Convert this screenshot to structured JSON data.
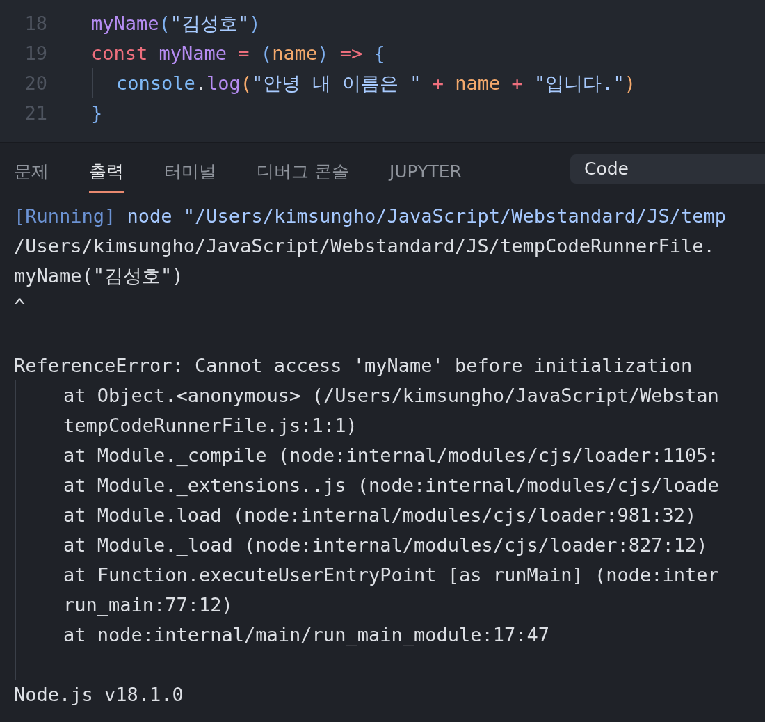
{
  "editor": {
    "lines": [
      {
        "number": "18",
        "guide": false,
        "tokens": [
          {
            "text": "myName",
            "kind": "fn"
          },
          {
            "text": "(",
            "kind": "punct"
          },
          {
            "text": "\"김성호\"",
            "kind": "str"
          },
          {
            "text": ")",
            "kind": "punct"
          }
        ]
      },
      {
        "number": "19",
        "guide": false,
        "tokens": [
          {
            "text": "const",
            "kind": "kw"
          },
          {
            "text": " myName",
            "kind": "fn"
          },
          {
            "text": " = ",
            "kind": "op"
          },
          {
            "text": "(",
            "kind": "punct"
          },
          {
            "text": "name",
            "kind": "param"
          },
          {
            "text": ")",
            "kind": "punct"
          },
          {
            "text": " => ",
            "kind": "op"
          },
          {
            "text": "{",
            "kind": "punct"
          }
        ]
      },
      {
        "number": "20",
        "guide": true,
        "tokens": [
          {
            "text": "console",
            "kind": "obj"
          },
          {
            "text": ".",
            "kind": "plain"
          },
          {
            "text": "log",
            "kind": "fn"
          },
          {
            "text": "(",
            "kind": "param"
          },
          {
            "text": "\"안녕 내 이름은 \"",
            "kind": "str"
          },
          {
            "text": " + ",
            "kind": "op"
          },
          {
            "text": "name",
            "kind": "param"
          },
          {
            "text": " + ",
            "kind": "op"
          },
          {
            "text": "\"입니다.\"",
            "kind": "str"
          },
          {
            "text": ")",
            "kind": "param"
          }
        ]
      },
      {
        "number": "21",
        "guide": false,
        "tokens": [
          {
            "text": "}",
            "kind": "punct"
          }
        ]
      }
    ]
  },
  "panel": {
    "tabs": [
      {
        "label": "문제",
        "selected": false
      },
      {
        "label": "출력",
        "selected": true
      },
      {
        "label": "터미널",
        "selected": false
      },
      {
        "label": "디버그 콘솔",
        "selected": false
      },
      {
        "label": "JUPYTER",
        "selected": false
      }
    ],
    "channel_dropdown": {
      "value": "Code"
    },
    "output": {
      "blocks": [
        {
          "lines": [
            [
              {
                "text": "[Running]",
                "kind": "tag"
              },
              {
                "text": " node \"/Users/kimsungho/JavaScript/Webstandard/JS/temp",
                "kind": "cmd"
              }
            ],
            [
              {
                "text": "/Users/kimsungho/JavaScript/Webstandard/JS/tempCodeRunnerFile.",
                "kind": "plain"
              }
            ],
            [
              {
                "text": "myName(\"김성호\")",
                "kind": "plain"
              }
            ],
            [
              {
                "text": "^",
                "kind": "plain"
              }
            ]
          ]
        },
        {
          "error": "ReferenceError: Cannot access 'myName' before initialization",
          "stack": [
            "at Object.<anonymous> (/Users/kimsungho/JavaScript/Webstan",
            "tempCodeRunnerFile.js:1:1)",
            "at Module._compile (node:internal/modules/cjs/loader:1105:",
            "at Module._extensions..js (node:internal/modules/cjs/loade",
            "at Module.load (node:internal/modules/cjs/loader:981:32)",
            "at Module._load (node:internal/modules/cjs/loader:827:12)",
            "at Function.executeUserEntryPoint [as runMain] (node:inter",
            "run_main:77:12)",
            "at node:internal/main/run_main_module:17:47"
          ]
        },
        {
          "lines": [
            [
              {
                "text": "Node.js v18.1.0",
                "kind": "plain"
              }
            ]
          ]
        }
      ]
    }
  }
}
